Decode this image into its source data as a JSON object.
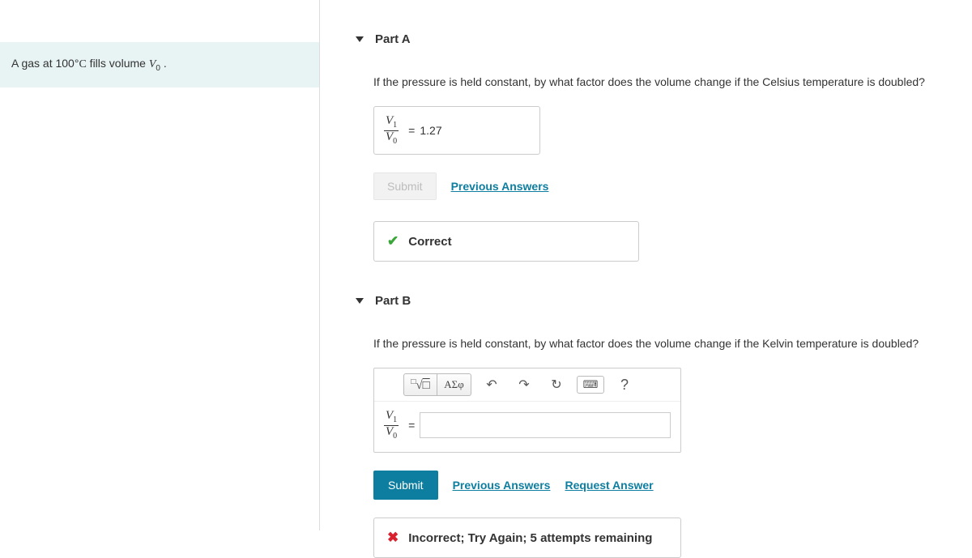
{
  "problem": {
    "prefix": "A gas at 100",
    "deg": "°",
    "unit": "C",
    "mid": " fills volume ",
    "var": "V",
    "sub": "0",
    "suffix": " ."
  },
  "partA": {
    "title": "Part A",
    "question": "If the pressure is held constant, by what factor does the volume change if the Celsius temperature is doubled?",
    "fraction": {
      "numV": "V",
      "numSub": "1",
      "denV": "V",
      "denSub": "0"
    },
    "equals": "=",
    "value": "1.27",
    "submit": "Submit",
    "previous": "Previous Answers",
    "feedback": "Correct"
  },
  "partB": {
    "title": "Part B",
    "question": "If the pressure is held constant, by what factor does the volume change if the Kelvin temperature is doubled?",
    "tools": {
      "roots": "√",
      "greek": "ΑΣφ",
      "undo": "↶",
      "redo": "↷",
      "reset": "↻",
      "keyboard": "⌨",
      "help": "?"
    },
    "fraction": {
      "numV": "V",
      "numSub": "1",
      "denV": "V",
      "denSub": "0"
    },
    "equals": "=",
    "submit": "Submit",
    "previous": "Previous Answers",
    "request": "Request Answer",
    "feedback": "Incorrect; Try Again; 5 attempts remaining"
  }
}
